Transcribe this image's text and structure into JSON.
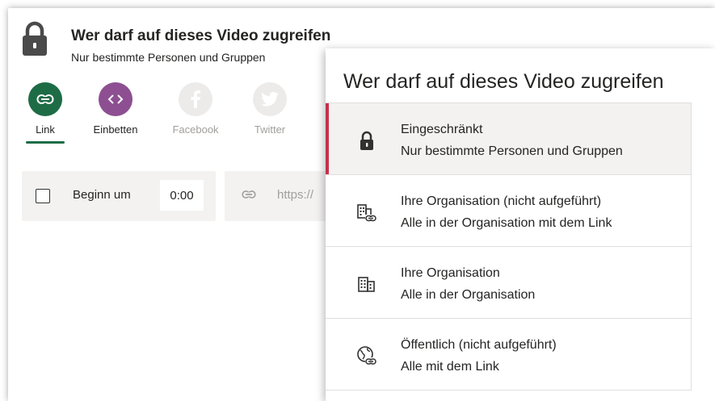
{
  "header": {
    "title": "Wer darf auf dieses Video zugreifen",
    "subtitle": "Nur bestimmte Personen und Gruppen"
  },
  "share_buttons": [
    {
      "label": "Link",
      "icon": "link-icon",
      "color": "#1e6c46",
      "active": true
    },
    {
      "label": "Einbetten",
      "icon": "code-icon",
      "color": "#8d4f91",
      "active": false
    },
    {
      "label": "Facebook",
      "icon": "facebook-icon",
      "color": "#edebe9",
      "active": false
    },
    {
      "label": "Twitter",
      "icon": "twitter-icon",
      "color": "#edebe9",
      "active": false
    }
  ],
  "start_at": {
    "label": "Beginn um",
    "value": "0:00",
    "checked": false
  },
  "url": {
    "text": "https://"
  },
  "popup": {
    "title": "Wer darf auf dieses Video zugreifen",
    "options": [
      {
        "title": "Eingeschränkt",
        "subtitle": "Nur bestimmte Personen und Gruppen",
        "icon": "lock-icon",
        "selected": true
      },
      {
        "title": "Ihre Organisation (nicht aufgeführt)",
        "subtitle": "Alle in der Organisation mit dem Link",
        "icon": "building-link-icon",
        "selected": false
      },
      {
        "title": "Ihre Organisation",
        "subtitle": "Alle in der Organisation",
        "icon": "building-icon",
        "selected": false
      },
      {
        "title": "Öffentlich (nicht aufgeführt)",
        "subtitle": "Alle mit dem Link",
        "icon": "globe-link-icon",
        "selected": false
      }
    ]
  },
  "colors": {
    "accent_green": "#1e6c46",
    "accent_purple": "#8d4f91",
    "selected_marker": "#c4314b"
  }
}
